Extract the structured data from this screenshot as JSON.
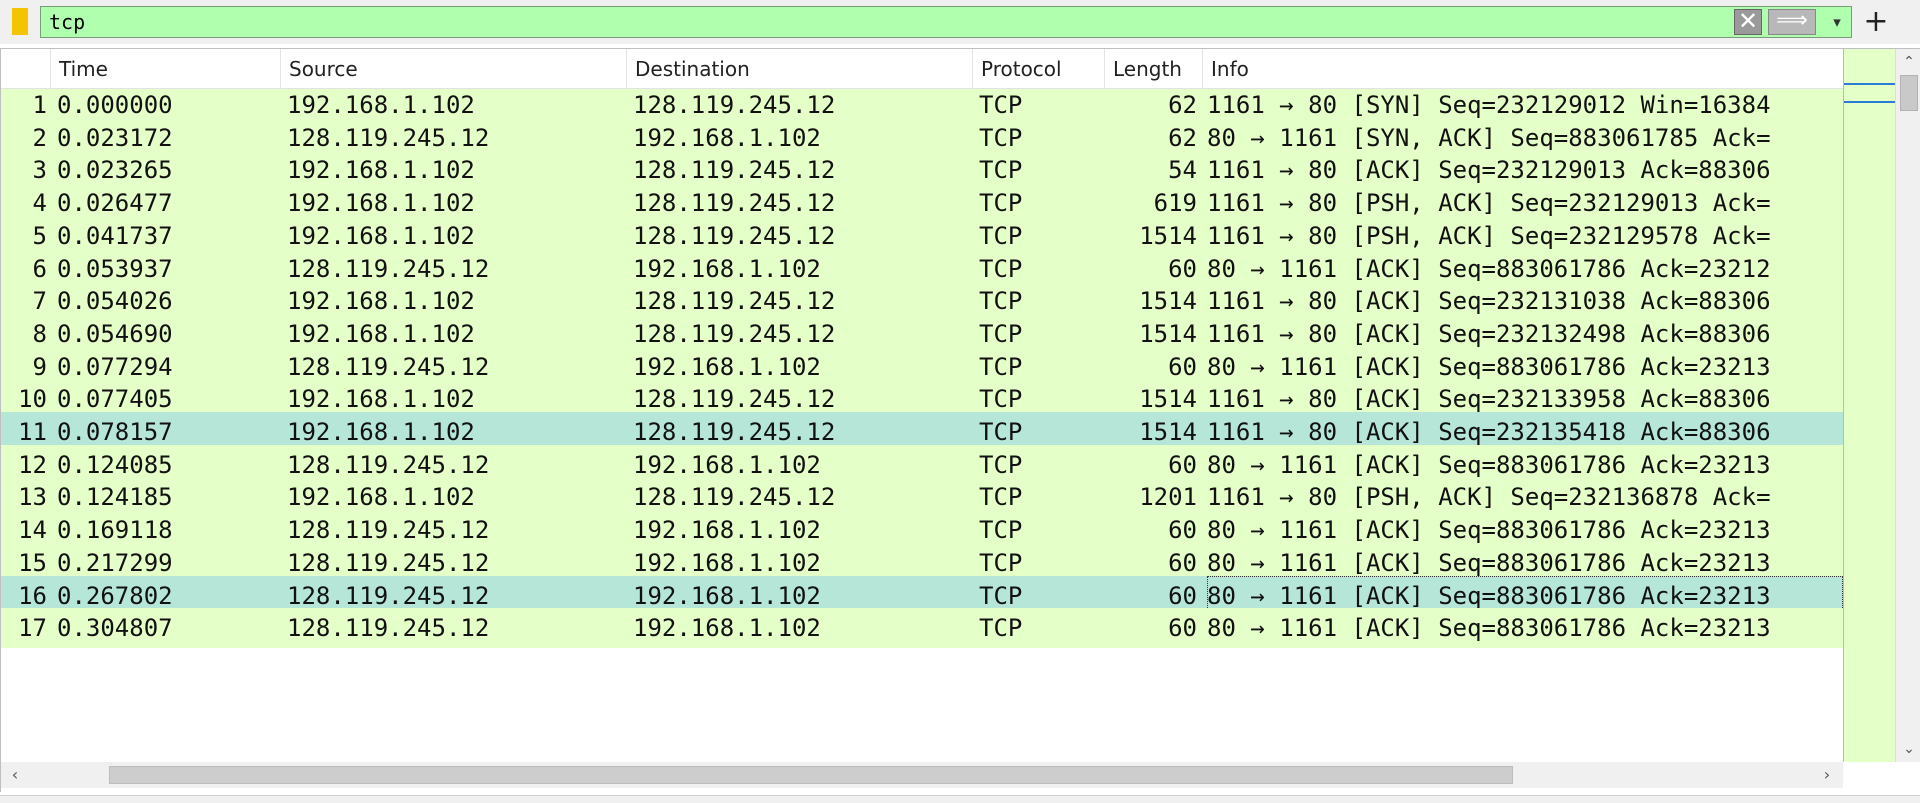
{
  "filter": {
    "value": "tcp",
    "clear_label": "✕",
    "apply_label": "⟹",
    "dropdown_label": "▾",
    "add_label": "+",
    "background": "#afffaf"
  },
  "columns": [
    "",
    "Time",
    "Source",
    "Destination",
    "Protocol",
    "Length",
    "Info"
  ],
  "colors": {
    "row_background": "#e4ffc7",
    "row_highlight": "#b5e6d8"
  },
  "packets": [
    {
      "no": "1",
      "time": "0.000000",
      "src": "192.168.1.102",
      "dst": "128.119.245.12",
      "proto": "TCP",
      "len": "62",
      "info": "1161 → 80 [SYN] Seq=232129012 Win=16384",
      "highlight": false
    },
    {
      "no": "2",
      "time": "0.023172",
      "src": "128.119.245.12",
      "dst": "192.168.1.102",
      "proto": "TCP",
      "len": "62",
      "info": "80 → 1161 [SYN, ACK] Seq=883061785 Ack=",
      "highlight": false
    },
    {
      "no": "3",
      "time": "0.023265",
      "src": "192.168.1.102",
      "dst": "128.119.245.12",
      "proto": "TCP",
      "len": "54",
      "info": "1161 → 80 [ACK] Seq=232129013 Ack=88306",
      "highlight": false
    },
    {
      "no": "4",
      "time": "0.026477",
      "src": "192.168.1.102",
      "dst": "128.119.245.12",
      "proto": "TCP",
      "len": "619",
      "info": "1161 → 80 [PSH, ACK] Seq=232129013 Ack=",
      "highlight": false
    },
    {
      "no": "5",
      "time": "0.041737",
      "src": "192.168.1.102",
      "dst": "128.119.245.12",
      "proto": "TCP",
      "len": "1514",
      "info": "1161 → 80 [PSH, ACK] Seq=232129578 Ack=",
      "highlight": false
    },
    {
      "no": "6",
      "time": "0.053937",
      "src": "128.119.245.12",
      "dst": "192.168.1.102",
      "proto": "TCP",
      "len": "60",
      "info": "80 → 1161 [ACK] Seq=883061786 Ack=23212",
      "highlight": false
    },
    {
      "no": "7",
      "time": "0.054026",
      "src": "192.168.1.102",
      "dst": "128.119.245.12",
      "proto": "TCP",
      "len": "1514",
      "info": "1161 → 80 [ACK] Seq=232131038 Ack=88306",
      "highlight": false
    },
    {
      "no": "8",
      "time": "0.054690",
      "src": "192.168.1.102",
      "dst": "128.119.245.12",
      "proto": "TCP",
      "len": "1514",
      "info": "1161 → 80 [ACK] Seq=232132498 Ack=88306",
      "highlight": false
    },
    {
      "no": "9",
      "time": "0.077294",
      "src": "128.119.245.12",
      "dst": "192.168.1.102",
      "proto": "TCP",
      "len": "60",
      "info": "80 → 1161 [ACK] Seq=883061786 Ack=23213",
      "highlight": false
    },
    {
      "no": "10",
      "time": "0.077405",
      "src": "192.168.1.102",
      "dst": "128.119.245.12",
      "proto": "TCP",
      "len": "1514",
      "info": "1161 → 80 [ACK] Seq=232133958 Ack=88306",
      "highlight": false
    },
    {
      "no": "11",
      "time": "0.078157",
      "src": "192.168.1.102",
      "dst": "128.119.245.12",
      "proto": "TCP",
      "len": "1514",
      "info": "1161 → 80 [ACK] Seq=232135418 Ack=88306",
      "highlight": true
    },
    {
      "no": "12",
      "time": "0.124085",
      "src": "128.119.245.12",
      "dst": "192.168.1.102",
      "proto": "TCP",
      "len": "60",
      "info": "80 → 1161 [ACK] Seq=883061786 Ack=23213",
      "highlight": false
    },
    {
      "no": "13",
      "time": "0.124185",
      "src": "192.168.1.102",
      "dst": "128.119.245.12",
      "proto": "TCP",
      "len": "1201",
      "info": "1161 → 80 [PSH, ACK] Seq=232136878 Ack=",
      "highlight": false
    },
    {
      "no": "14",
      "time": "0.169118",
      "src": "128.119.245.12",
      "dst": "192.168.1.102",
      "proto": "TCP",
      "len": "60",
      "info": "80 → 1161 [ACK] Seq=883061786 Ack=23213",
      "highlight": false
    },
    {
      "no": "15",
      "time": "0.217299",
      "src": "128.119.245.12",
      "dst": "192.168.1.102",
      "proto": "TCP",
      "len": "60",
      "info": "80 → 1161 [ACK] Seq=883061786 Ack=23213",
      "highlight": false
    },
    {
      "no": "16",
      "time": "0.267802",
      "src": "128.119.245.12",
      "dst": "192.168.1.102",
      "proto": "TCP",
      "len": "60",
      "info": "80 → 1161 [ACK] Seq=883061786 Ack=23213",
      "highlight": true
    },
    {
      "no": "17",
      "time": "0.304807",
      "src": "128.119.245.12",
      "dst": "192.168.1.102",
      "proto": "TCP",
      "len": "60",
      "info": "80 → 1161 [ACK] Seq=883061786 Ack=23213",
      "highlight": false
    }
  ],
  "scrollbars": {
    "up_label": "⌃",
    "down_label": "⌄",
    "left_label": "‹",
    "right_label": "›"
  }
}
